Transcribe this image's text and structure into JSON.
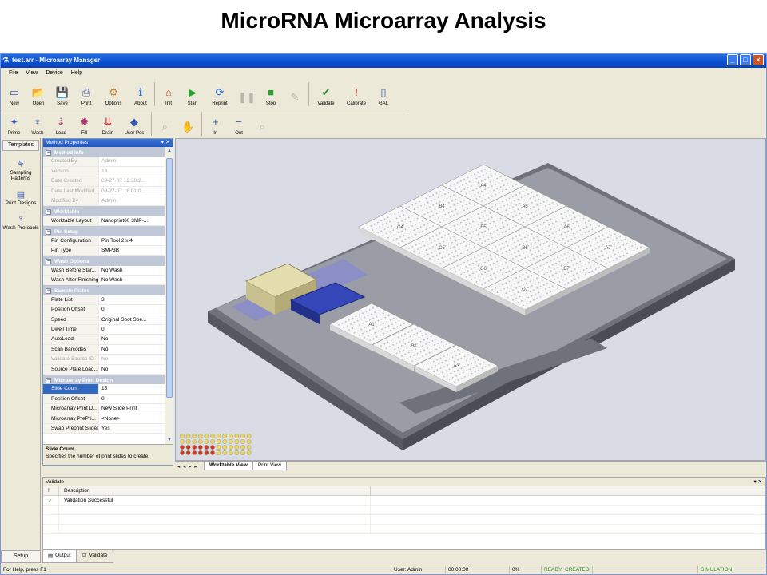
{
  "slide": {
    "title": "MicroRNA Microarray Analysis"
  },
  "window": {
    "title": "test.arr - Microarray Manager"
  },
  "menu": [
    "File",
    "View",
    "Device",
    "Help"
  ],
  "toolbar1": [
    {
      "label": "New",
      "icon": "new-file-icon",
      "disabled": false
    },
    {
      "label": "Open",
      "icon": "open-folder-icon",
      "disabled": false
    },
    {
      "label": "Save",
      "icon": "save-disk-icon",
      "disabled": false
    },
    {
      "label": "Print",
      "icon": "printer-icon",
      "disabled": false
    },
    {
      "label": "Options",
      "icon": "options-icon",
      "disabled": false
    },
    {
      "label": "About",
      "icon": "info-icon",
      "disabled": false
    },
    {
      "label": "Init",
      "icon": "init-icon",
      "disabled": false
    },
    {
      "label": "Start",
      "icon": "play-icon",
      "disabled": false
    },
    {
      "label": "Reprint",
      "icon": "reprint-icon",
      "disabled": false
    },
    {
      "label": "",
      "icon": "pause-icon",
      "disabled": true
    },
    {
      "label": "Stop",
      "icon": "stop-icon",
      "disabled": false
    },
    {
      "label": "",
      "icon": "tool-icon",
      "disabled": true
    },
    {
      "label": "Validate",
      "icon": "validate-icon",
      "disabled": false
    },
    {
      "label": "Calibrate",
      "icon": "calibrate-icon",
      "disabled": false
    },
    {
      "label": "GAL",
      "icon": "gal-icon",
      "disabled": false
    }
  ],
  "toolbar2": [
    {
      "label": "Prime",
      "icon": "prime-icon",
      "disabled": false
    },
    {
      "label": "Wash",
      "icon": "wash-icon",
      "disabled": false
    },
    {
      "label": "Load",
      "icon": "load-icon",
      "disabled": false
    },
    {
      "label": "Fill",
      "icon": "fill-icon",
      "disabled": false
    },
    {
      "label": "Drain",
      "icon": "drain-icon",
      "disabled": false
    },
    {
      "label": "User Pos",
      "icon": "user-pos-icon",
      "disabled": false
    },
    {
      "label": "",
      "icon": "zoom-icon",
      "disabled": true
    },
    {
      "label": "",
      "icon": "pan-hand-icon",
      "disabled": true
    },
    {
      "label": "In",
      "icon": "zoom-in-icon",
      "disabled": false
    },
    {
      "label": "Out",
      "icon": "zoom-out-icon",
      "disabled": false
    },
    {
      "label": "",
      "icon": "zoom-fit-icon",
      "disabled": true
    }
  ],
  "leftbar": {
    "tab": "Templates",
    "items": [
      {
        "label": "Sampling Patterns",
        "icon": "sampling-patterns-icon"
      },
      {
        "label": "Print Designs",
        "icon": "print-designs-icon"
      },
      {
        "label": "Wash Protocols",
        "icon": "wash-protocols-icon"
      }
    ],
    "setup": "Setup"
  },
  "properties": {
    "header": "Method Properties",
    "sections": [
      {
        "name": "Method Info",
        "rows": [
          {
            "key": "Created By",
            "value": "Admin",
            "readonly": true
          },
          {
            "key": "Version",
            "value": "18",
            "readonly": true
          },
          {
            "key": "Date Created",
            "value": "09-27-07 12:30:2...",
            "readonly": true
          },
          {
            "key": "Date Last Modified",
            "value": "09-27-07 16:01:0...",
            "readonly": true
          },
          {
            "key": "Modified By",
            "value": "Admin",
            "readonly": true
          }
        ]
      },
      {
        "name": "Worktable",
        "rows": [
          {
            "key": "Worktable Layout",
            "value": "Nanoprint60 3MP-...",
            "readonly": false
          }
        ]
      },
      {
        "name": "Pin Setup",
        "rows": [
          {
            "key": "Pin Configuration",
            "value": "Pin Tool 2 x 4",
            "readonly": false
          },
          {
            "key": "Pin Type",
            "value": "SMP3B",
            "readonly": false
          }
        ]
      },
      {
        "name": "Wash Options",
        "rows": [
          {
            "key": "Wash Before Star...",
            "value": "No Wash",
            "readonly": false
          },
          {
            "key": "Wash After Finishing",
            "value": "No Wash",
            "readonly": false
          }
        ]
      },
      {
        "name": "Sample Plates",
        "rows": [
          {
            "key": "Plate List",
            "value": "3",
            "readonly": false
          },
          {
            "key": "Position Offset",
            "value": "0",
            "readonly": false
          },
          {
            "key": "Speed",
            "value": "Original Spot Spe...",
            "readonly": false
          },
          {
            "key": "Dwell Time",
            "value": "0",
            "readonly": false
          },
          {
            "key": "AutoLoad",
            "value": "No",
            "readonly": false
          },
          {
            "key": "Scan Barcodes",
            "value": "No",
            "readonly": false
          },
          {
            "key": "Validate Source ID",
            "value": "No",
            "readonly": true
          },
          {
            "key": "Source Plate Load...",
            "value": "No",
            "readonly": false
          }
        ]
      },
      {
        "name": "Microarray Print Design",
        "rows": [
          {
            "key": "Slide Count",
            "value": "15",
            "readonly": false,
            "selected": true
          },
          {
            "key": "Position Offset",
            "value": "0",
            "readonly": false
          },
          {
            "key": "Microarray Print D...",
            "value": "New Slide Print",
            "readonly": false
          },
          {
            "key": "Microarray PrePri...",
            "value": "<None>",
            "readonly": false
          },
          {
            "key": "Swap Preprint Slides",
            "value": "Yes",
            "readonly": false
          }
        ]
      }
    ],
    "description": {
      "title": "Slide Count",
      "text": "Specifies the number of print slides to create."
    }
  },
  "viewport": {
    "plate_labels": [
      "A4",
      "B4",
      "C4",
      "A5",
      "B5",
      "C5",
      "A6",
      "B6",
      "C6",
      "A7",
      "B7",
      "C7",
      "A1",
      "A2",
      "A3"
    ],
    "colors": {
      "background": "#d9dce4",
      "deck": "#8a8d96",
      "plate": "#f4f4f4",
      "holder": "#d6cfa0",
      "station": "#2a3aa8"
    }
  },
  "view_tabs": [
    "Worktable View",
    "Print View"
  ],
  "validate_panel": {
    "title": "Validate",
    "columns": [
      "!",
      "Description"
    ],
    "rows": [
      {
        "status": "✓",
        "description": "Validation Successful"
      }
    ]
  },
  "bottom_tabs": [
    "Output",
    "Validate"
  ],
  "status": {
    "help": "For Help, press F1",
    "user": "User: Admin",
    "time": "00:00:00",
    "percent": "0%",
    "flags": [
      "READY",
      "CREATED"
    ],
    "mode": "SIMULATION"
  }
}
